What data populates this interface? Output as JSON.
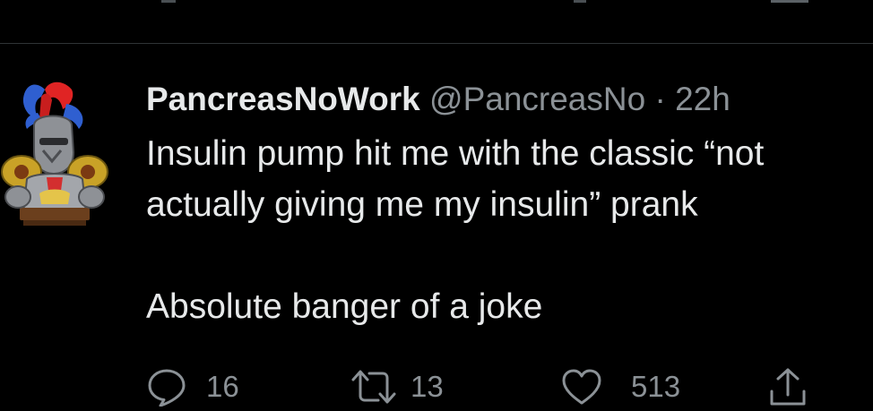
{
  "tweet": {
    "display_name": "PancreasNoWork",
    "handle": "@PancreasNo",
    "separator": "·",
    "time": "22h",
    "text_line_1": "Insulin pump hit me with the classic “not",
    "text_line_2": "actually giving me my insulin” prank",
    "text_line_3": "Absolute banger of a joke"
  },
  "actions": {
    "reply_icon": "reply-icon",
    "reply_count": "16",
    "retweet_icon": "retweet-icon",
    "retweet_count": "13",
    "like_icon": "heart-icon",
    "like_count": "513",
    "share_icon": "share-icon"
  },
  "colors": {
    "background": "#000000",
    "primary_text": "#e7e9ea",
    "secondary_text": "#8b9196",
    "divider": "#2f3336"
  }
}
